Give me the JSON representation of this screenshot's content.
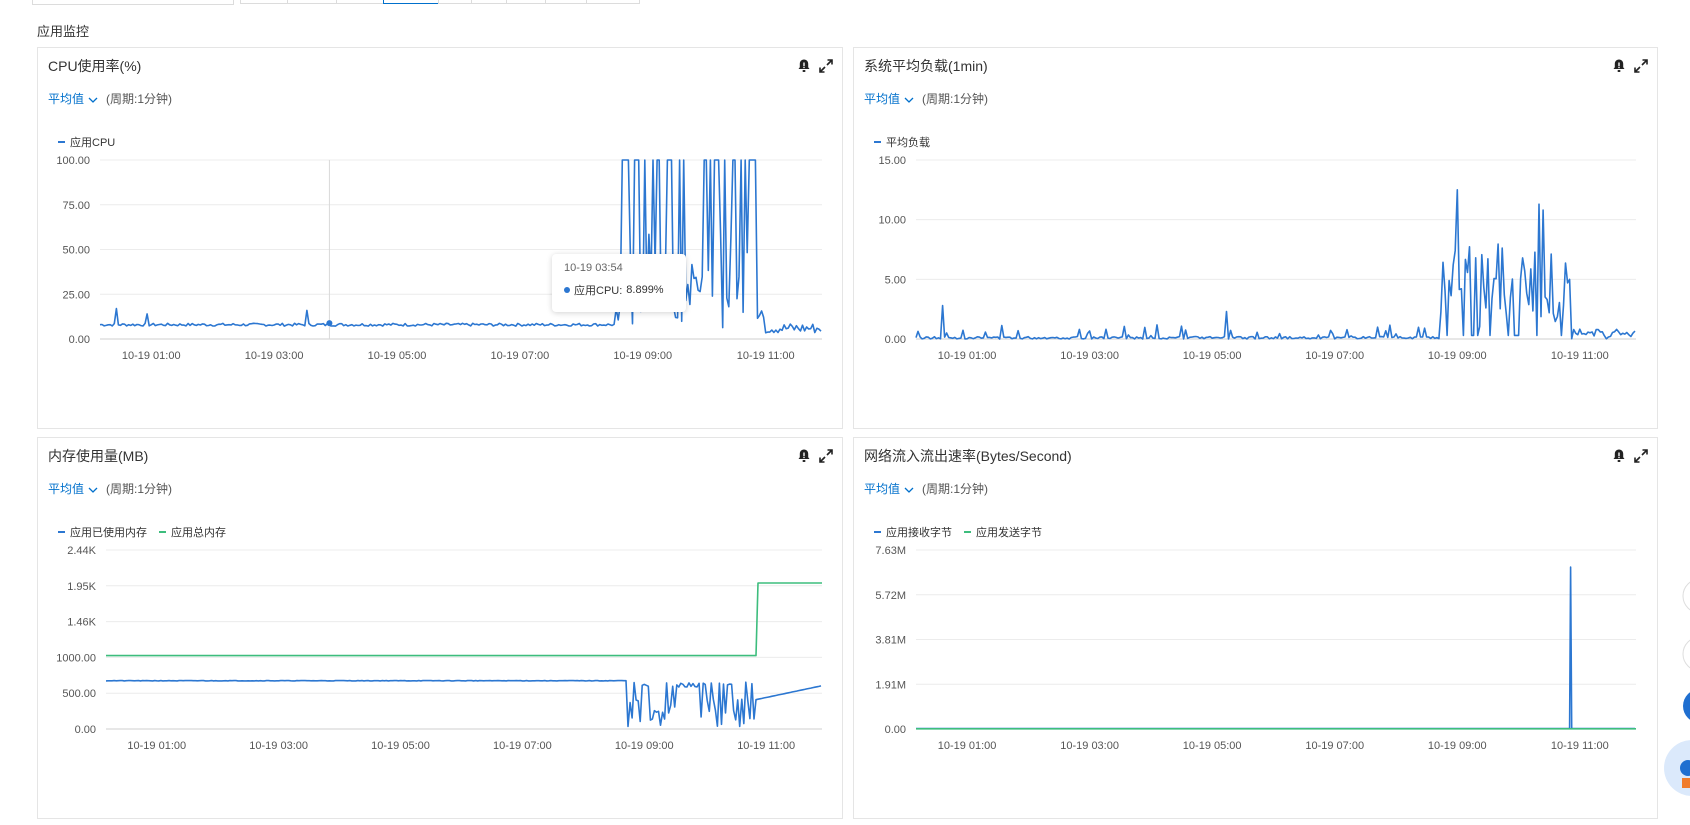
{
  "section_title": "应用监控",
  "colors": {
    "blue": "#2c77d1",
    "green": "#3dbd7d",
    "link": "#0070cc",
    "grid": "#e9e9e9",
    "axis": "#cccccc"
  },
  "icons": {
    "alarm": "bell-icon",
    "expand": "expand-icon",
    "dropdown": "chevron-down-icon"
  },
  "charts": [
    {
      "title": "CPU使用率(%)",
      "agg_label": "平均值",
      "period": "(周期:1分钟)",
      "legend": [
        {
          "name": "应用CPU",
          "color": "#2c77d1"
        }
      ],
      "y_ticks": [
        "100.00",
        "75.00",
        "50.00",
        "25.00",
        "0.00"
      ],
      "x_ticks": [
        "10-19 01:00",
        "10-19 03:00",
        "10-19 05:00",
        "10-19 07:00",
        "10-19 09:00",
        "10-19 11:00"
      ],
      "tooltip": {
        "time": "10-19 03:54",
        "series": "应用CPU:",
        "value": "8.899%"
      }
    },
    {
      "title": "系统平均负载(1min)",
      "agg_label": "平均值",
      "period": "(周期:1分钟)",
      "legend": [
        {
          "name": "平均负载",
          "color": "#2c77d1"
        }
      ],
      "y_ticks": [
        "15.00",
        "10.00",
        "5.00",
        "0.00"
      ],
      "x_ticks": [
        "10-19 01:00",
        "10-19 03:00",
        "10-19 05:00",
        "10-19 07:00",
        "10-19 09:00",
        "10-19 11:00"
      ]
    },
    {
      "title": "内存使用量(MB)",
      "agg_label": "平均值",
      "period": "(周期:1分钟)",
      "legend": [
        {
          "name": "应用已使用内存",
          "color": "#2c77d1"
        },
        {
          "name": "应用总内存",
          "color": "#3dbd7d"
        }
      ],
      "y_ticks": [
        "2.44K",
        "1.95K",
        "1.46K",
        "1000.00",
        "500.00",
        "0.00"
      ],
      "x_ticks": [
        "10-19 01:00",
        "10-19 03:00",
        "10-19 05:00",
        "10-19 07:00",
        "10-19 09:00",
        "10-19 11:00"
      ]
    },
    {
      "title": "网络流入流出速率(Bytes/Second)",
      "agg_label": "平均值",
      "period": "(周期:1分钟)",
      "legend": [
        {
          "name": "应用接收字节",
          "color": "#2c77d1"
        },
        {
          "name": "应用发送字节",
          "color": "#3dbd7d"
        }
      ],
      "y_ticks": [
        "7.63M",
        "5.72M",
        "3.81M",
        "1.91M",
        "0.00"
      ],
      "x_ticks": [
        "10-19 01:00",
        "10-19 03:00",
        "10-19 05:00",
        "10-19 07:00",
        "10-19 09:00",
        "10-19 11:00"
      ]
    }
  ],
  "chart_data": [
    {
      "type": "line",
      "title": "CPU使用率(%)",
      "xlabel": "",
      "ylabel": "",
      "x_range": [
        "10-19 00:10",
        "10-19 11:55"
      ],
      "ylim": [
        0,
        100
      ],
      "series": [
        {
          "name": "应用CPU",
          "description_of_shape": "baseline ~8% from 00:10 to 08:30 with small spikes to ~17% near 00:25, 00:55, 03:30; from ~08:40 to ~10:50 heavy oscillation between ~5% and 100%; after 10:55 drops to ~3-8%",
          "points": [
            [
              "00:10",
              8
            ],
            [
              "00:25",
              17
            ],
            [
              "00:30",
              8
            ],
            [
              "00:55",
              15
            ],
            [
              "01:00",
              8
            ],
            [
              "02:00",
              8
            ],
            [
              "03:00",
              8
            ],
            [
              "03:30",
              16
            ],
            [
              "03:35",
              8
            ],
            [
              "03:54",
              8.899
            ],
            [
              "05:00",
              8
            ],
            [
              "07:00",
              8
            ],
            [
              "08:30",
              8
            ],
            [
              "08:35",
              17
            ],
            [
              "08:40",
              100
            ],
            [
              "09:00",
              30
            ],
            [
              "09:20",
              100
            ],
            [
              "09:40",
              20
            ],
            [
              "10:00",
              100
            ],
            [
              "10:20",
              50
            ],
            [
              "10:40",
              100
            ],
            [
              "10:50",
              0
            ],
            [
              "10:55",
              10
            ],
            [
              "11:30",
              5
            ],
            [
              "11:55",
              7
            ]
          ]
        }
      ],
      "grid": true,
      "legend": "top-left"
    },
    {
      "type": "line",
      "title": "系统平均负载(1min)",
      "ylim": [
        0,
        15
      ],
      "series": [
        {
          "name": "平均负载",
          "points": [
            [
              "00:10",
              0.2
            ],
            [
              "00:30",
              0.3
            ],
            [
              "00:35",
              2.8
            ],
            [
              "00:40",
              0.1
            ],
            [
              "01:00",
              0.3
            ],
            [
              "02:00",
              0.2
            ],
            [
              "03:00",
              0.4
            ],
            [
              "04:00",
              0.3
            ],
            [
              "05:00",
              0.8
            ],
            [
              "05:15",
              2.4
            ],
            [
              "06:00",
              0.4
            ],
            [
              "07:00",
              0.3
            ],
            [
              "08:30",
              0.5
            ],
            [
              "08:45",
              6
            ],
            [
              "09:00",
              12.5
            ],
            [
              "09:10",
              4
            ],
            [
              "09:30",
              8
            ],
            [
              "09:50",
              3
            ],
            [
              "10:10",
              9
            ],
            [
              "10:20",
              11.3
            ],
            [
              "10:30",
              3
            ],
            [
              "10:45",
              6
            ],
            [
              "11:00",
              0.8
            ],
            [
              "11:30",
              0.6
            ],
            [
              "11:55",
              0.4
            ]
          ]
        }
      ],
      "grid": true,
      "legend": "top-left"
    },
    {
      "type": "line",
      "title": "内存使用量(MB)",
      "ylim": [
        0,
        2440
      ],
      "series": [
        {
          "name": "应用已使用内存",
          "points": [
            [
              "00:10",
              660
            ],
            [
              "08:40",
              660
            ],
            [
              "08:45",
              150
            ],
            [
              "09:00",
              600
            ],
            [
              "09:30",
              100
            ],
            [
              "10:00",
              600
            ],
            [
              "10:30",
              50
            ],
            [
              "10:50",
              400
            ],
            [
              "11:00",
              550
            ],
            [
              "11:30",
              580
            ],
            [
              "11:55",
              590
            ]
          ]
        },
        {
          "name": "应用总内存",
          "points": [
            [
              "00:10",
              1000
            ],
            [
              "10:50",
              1000
            ],
            [
              "10:52",
              1990
            ],
            [
              "11:55",
              1990
            ]
          ]
        }
      ],
      "grid": true,
      "legend": "top-left"
    },
    {
      "type": "line",
      "title": "网络流入流出速率(Bytes/Second)",
      "ylim": [
        0,
        7630000
      ],
      "series": [
        {
          "name": "应用接收字节",
          "points": [
            [
              "00:10",
              10000
            ],
            [
              "10:50",
              10000
            ],
            [
              "10:51",
              6900000
            ],
            [
              "10:52",
              10000
            ],
            [
              "11:55",
              10000
            ]
          ]
        },
        {
          "name": "应用发送字节",
          "points": [
            [
              "00:10",
              8000
            ],
            [
              "11:55",
              8000
            ]
          ]
        }
      ],
      "grid": true,
      "legend": "top-left"
    }
  ]
}
